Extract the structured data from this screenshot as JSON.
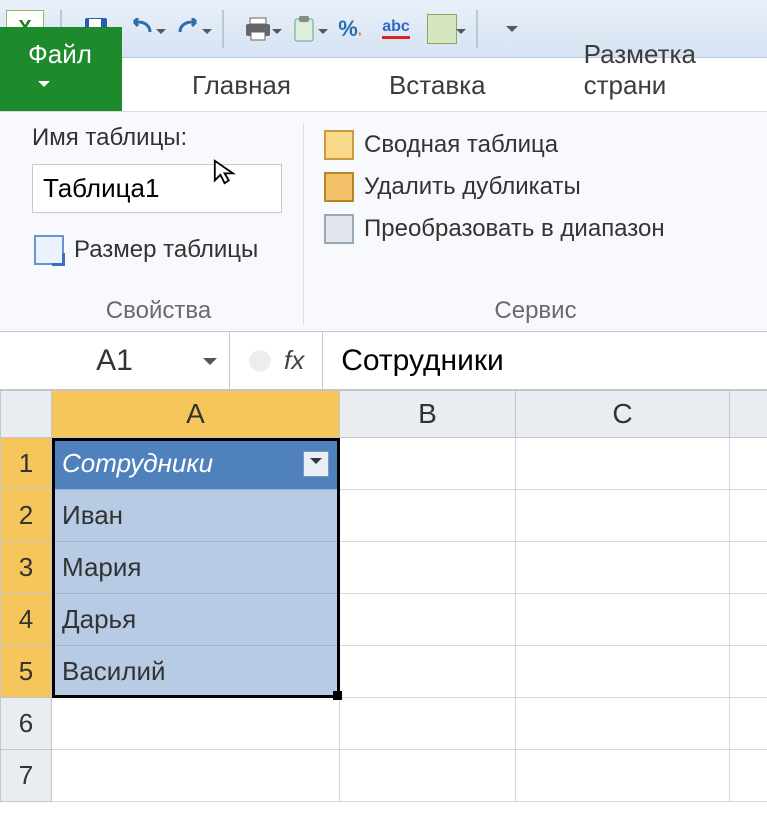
{
  "qat": {
    "app_letter": "X"
  },
  "tabs": {
    "file": "Файл",
    "home": "Главная",
    "insert": "Вставка",
    "pagelayout": "Разметка страни"
  },
  "ribbon": {
    "props_group": {
      "label": "Имя таблицы:",
      "table_name": "Таблица1",
      "resize": "Размер таблицы",
      "title": "Свойства"
    },
    "tools_group": {
      "pivot": "Сводная таблица",
      "dedup": "Удалить дубликаты",
      "convert": "Преобразовать в диапазон",
      "title": "Сервис"
    }
  },
  "fbar": {
    "name_box": "A1",
    "fx": "fx",
    "formula": "Сотрудники"
  },
  "columns": [
    "A",
    "B",
    "C"
  ],
  "row_numbers": [
    "1",
    "2",
    "3",
    "4",
    "5",
    "6",
    "7"
  ],
  "table": {
    "header": "Сотрудники",
    "rows": [
      "Иван",
      "Мария",
      "Дарья",
      "Василий"
    ]
  }
}
